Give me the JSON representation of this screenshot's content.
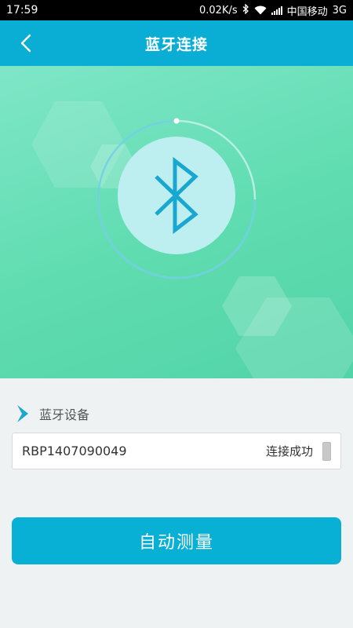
{
  "status_bar": {
    "time": "17:59",
    "net_speed": "0.02K/s",
    "carrier": "中国移动",
    "network_type": "3G",
    "icons": [
      "bluetooth-icon",
      "wifi-icon",
      "signal-icon"
    ]
  },
  "header": {
    "title": "蓝牙连接",
    "back_icon": "chevron-left-icon"
  },
  "hero": {
    "icon": "bluetooth-icon"
  },
  "device_section": {
    "label": "蓝牙设备",
    "arrow_icon": "chevron-right-icon"
  },
  "device": {
    "id": "RBP1407090049",
    "status": "连接成功"
  },
  "actions": {
    "auto_measure_label": "自动测量"
  },
  "colors": {
    "header_bg": "#0aaed4",
    "hero_green": "#5fdcb0",
    "button_bg": "#08b0d6",
    "page_bg": "#eef2f2"
  }
}
